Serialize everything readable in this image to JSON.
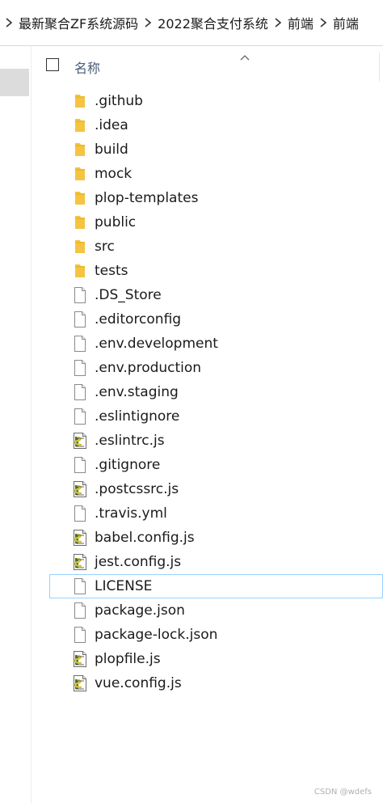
{
  "breadcrumb": {
    "items": [
      "最新聚合ZF系统源码",
      "2022聚合支付系统",
      "前端",
      "前端"
    ]
  },
  "header": {
    "name_column_label": "名称",
    "sort_direction": "ascending"
  },
  "files": [
    {
      "name": ".github",
      "type": "folder"
    },
    {
      "name": ".idea",
      "type": "folder"
    },
    {
      "name": "build",
      "type": "folder"
    },
    {
      "name": "mock",
      "type": "folder"
    },
    {
      "name": "plop-templates",
      "type": "folder"
    },
    {
      "name": "public",
      "type": "folder"
    },
    {
      "name": "src",
      "type": "folder"
    },
    {
      "name": "tests",
      "type": "folder"
    },
    {
      "name": ".DS_Store",
      "type": "file"
    },
    {
      "name": ".editorconfig",
      "type": "file"
    },
    {
      "name": ".env.development",
      "type": "file"
    },
    {
      "name": ".env.production",
      "type": "file"
    },
    {
      "name": ".env.staging",
      "type": "file"
    },
    {
      "name": ".eslintignore",
      "type": "file"
    },
    {
      "name": ".eslintrc.js",
      "type": "script"
    },
    {
      "name": ".gitignore",
      "type": "file"
    },
    {
      "name": ".postcssrc.js",
      "type": "script"
    },
    {
      "name": ".travis.yml",
      "type": "file"
    },
    {
      "name": "babel.config.js",
      "type": "script"
    },
    {
      "name": "jest.config.js",
      "type": "script"
    },
    {
      "name": "LICENSE",
      "type": "file",
      "focused": true
    },
    {
      "name": "package.json",
      "type": "file"
    },
    {
      "name": "package-lock.json",
      "type": "file"
    },
    {
      "name": "plopfile.js",
      "type": "script"
    },
    {
      "name": "vue.config.js",
      "type": "script"
    }
  ],
  "icons": {
    "folder": "folder-icon",
    "file": "file-icon",
    "script": "script-file-icon",
    "separator": "chevron-right-icon",
    "sort": "sort-up-icon"
  },
  "colors": {
    "folder": "#f4c542",
    "focus_border": "#99d1ff",
    "header_text": "#4a5b79",
    "nav_selected": "#dcdcdc"
  },
  "watermark": "CSDN @wdefs"
}
